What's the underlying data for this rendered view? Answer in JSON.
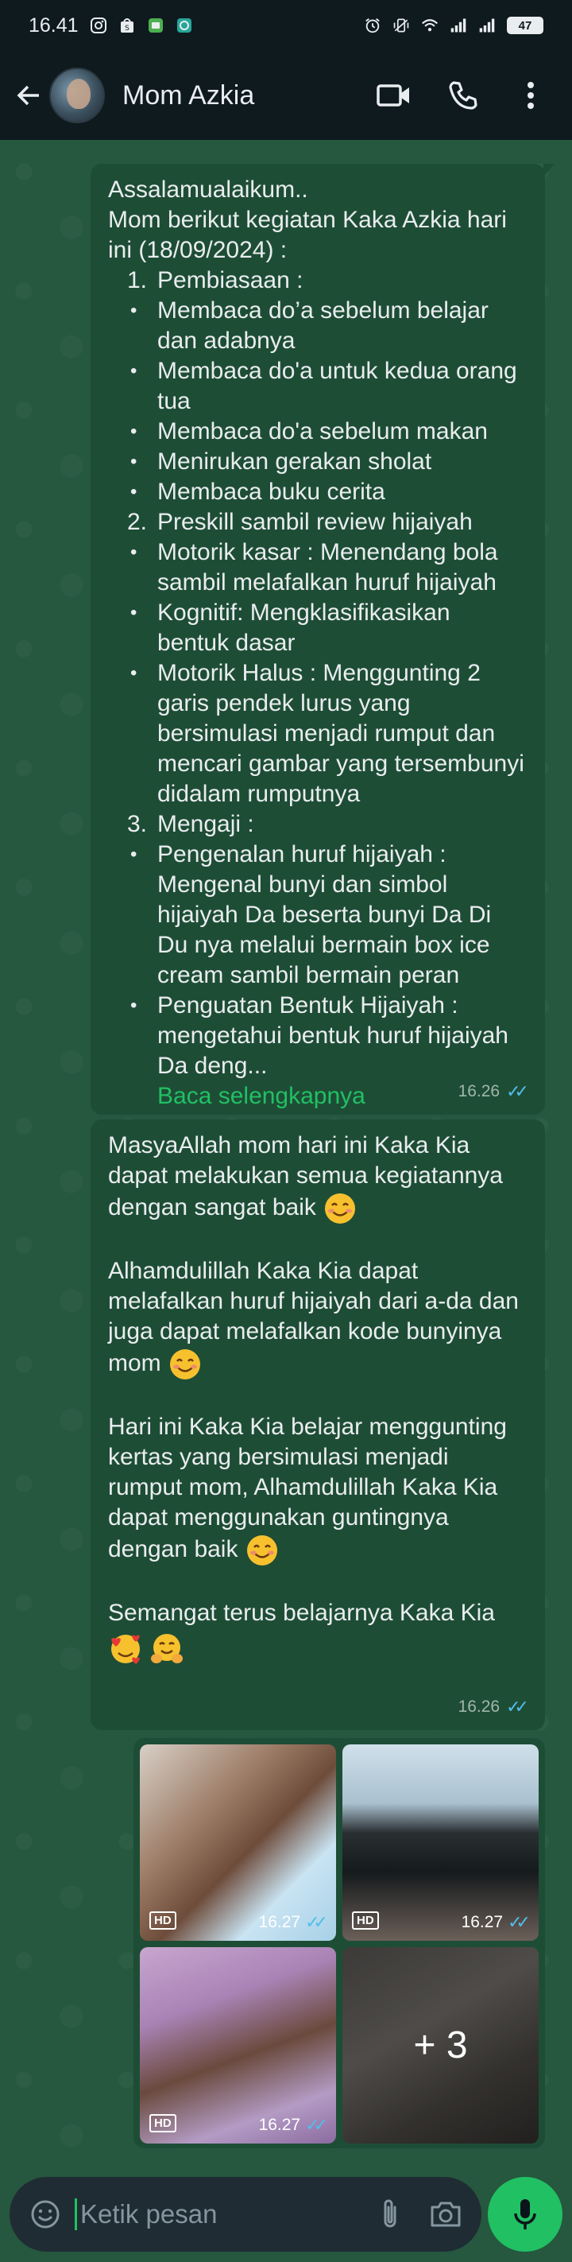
{
  "status_bar": {
    "time": "16.41",
    "battery": "47"
  },
  "header": {
    "contact_name": "Mom Azkia"
  },
  "message1": {
    "greeting": "Assalamualaikum..",
    "intro": "Mom berikut kegiatan Kaka Azkia hari ini (18/09/2024) :",
    "items": [
      {
        "type": "num",
        "marker": "1.",
        "text": "Pembiasaan :"
      },
      {
        "type": "bullet",
        "text": "Membaca do’a sebelum belajar dan adabnya"
      },
      {
        "type": "bullet",
        "text": "Membaca do'a untuk kedua orang tua"
      },
      {
        "type": "bullet",
        "text": "Membaca do'a sebelum makan"
      },
      {
        "type": "bullet",
        "text": "Menirukan gerakan sholat"
      },
      {
        "type": "bullet",
        "text": "Membaca buku cerita"
      },
      {
        "type": "num",
        "marker": "2.",
        "text": "Preskill sambil review hijaiyah"
      },
      {
        "type": "bullet",
        "text": "Motorik kasar :  Menendang bola sambil melafalkan huruf hijaiyah"
      },
      {
        "type": "bullet",
        "text": "Kognitif:  Mengklasifikasikan bentuk dasar"
      },
      {
        "type": "bullet",
        "text": "Motorik Halus : Menggunting 2 garis pendek lurus yang bersimulasi menjadi rumput dan mencari gambar yang tersembunyi didalam rumputnya"
      },
      {
        "type": "num",
        "marker": "3.",
        "text": "Mengaji :"
      },
      {
        "type": "bullet",
        "text": "Pengenalan huruf hijaiyah : Mengenal bunyi dan simbol hijaiyah Da beserta bunyi Da Di Du nya melalui bermain box ice cream sambil bermain peran"
      },
      {
        "type": "bullet",
        "text": "Penguatan Bentuk Hijaiyah : mengetahui bentuk huruf hijaiyah Da   deng..."
      }
    ],
    "read_more": "Baca selengkapnya",
    "time": "16.26"
  },
  "message2": {
    "para1": "MasyaAllah mom hari ini Kaka Kia dapat melakukan semua kegiatannya dengan sangat baik",
    "para2": "Alhamdulillah Kaka Kia dapat melafalkan huruf hijaiyah dari a-da dan juga dapat melafalkan kode bunyinya mom",
    "para3": "Hari ini Kaka Kia belajar menggunting kertas yang bersimulasi menjadi rumput mom, Alhamdulillah Kaka Kia dapat menggunakan guntingnya dengan baik",
    "para4": "Semangat terus belajarnya Kaka Kia",
    "time": "16.26"
  },
  "media": {
    "hd_label": "HD",
    "photos": [
      {
        "time": "16.27"
      },
      {
        "time": "16.27"
      },
      {
        "time": "16.27"
      }
    ],
    "more_count": "+ 3"
  },
  "input": {
    "placeholder": "Ketik pesan"
  },
  "colors": {
    "accent": "#21c063",
    "read_ticks": "#53bdeb",
    "bubble": "#1e4d36",
    "header_bg": "#0f1a1f"
  },
  "icons": [
    "instagram-icon",
    "shopee-icon",
    "messages-icon",
    "chat-icon",
    "alarm-icon",
    "vibrate-icon",
    "wifi-icon",
    "signal-icon",
    "back-arrow-icon",
    "video-call-icon",
    "phone-icon",
    "more-vert-icon",
    "emoji-icon",
    "attach-icon",
    "camera-icon",
    "mic-icon"
  ]
}
